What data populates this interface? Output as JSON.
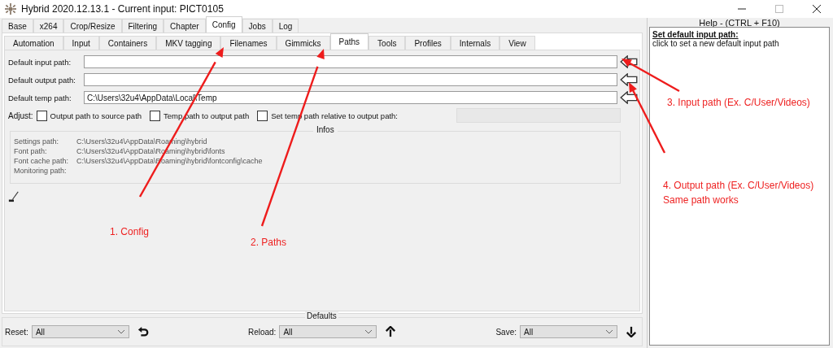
{
  "window": {
    "title": "Hybrid 2020.12.13.1 - Current input: PICT0105"
  },
  "tabs": [
    {
      "label": "Base",
      "selected": false
    },
    {
      "label": "x264",
      "selected": false
    },
    {
      "label": "Crop/Resize",
      "selected": false
    },
    {
      "label": "Filtering",
      "selected": false
    },
    {
      "label": "Chapter",
      "selected": false
    },
    {
      "label": "Config",
      "selected": true
    },
    {
      "label": "Jobs",
      "selected": false
    },
    {
      "label": "Log",
      "selected": false
    }
  ],
  "subtabs": [
    {
      "label": "Automation",
      "selected": false
    },
    {
      "label": "Input",
      "selected": false
    },
    {
      "label": "Containers",
      "selected": false
    },
    {
      "label": "MKV tagging",
      "selected": false
    },
    {
      "label": "Filenames",
      "selected": false
    },
    {
      "label": "Gimmicks",
      "selected": false
    },
    {
      "label": "Paths",
      "selected": true
    },
    {
      "label": "Tools",
      "selected": false
    },
    {
      "label": "Profiles",
      "selected": false
    },
    {
      "label": "Internals",
      "selected": false
    },
    {
      "label": "View",
      "selected": false
    }
  ],
  "paths": [
    {
      "label": "Default input path:"
    },
    {
      "label": "Default output path:"
    },
    {
      "label": "Default temp path:",
      "value": "C:\\Users\\32u4\\AppData\\Local\\Temp"
    }
  ],
  "adjust": {
    "label": "Adjust:",
    "options": [
      {
        "label": "Output path to source path",
        "checked": false
      },
      {
        "label": "Temp path to output path",
        "checked": false
      },
      {
        "label": "Set temp path relative to output path:",
        "checked": false
      }
    ]
  },
  "infos": {
    "title": "Infos",
    "rows": [
      {
        "label": "Settings path:",
        "value": "C:\\Users\\32u4\\AppData\\Roaming\\hybrid"
      },
      {
        "label": "Font path:",
        "value": "C:\\Users\\32u4\\AppData\\Roaming\\hybrid\\fonts"
      },
      {
        "label": "Font cache path:",
        "value": "C:\\Users\\32u4\\AppData\\Roaming\\hybrid\\fontconfig\\cache"
      },
      {
        "label": "Monitoring path:"
      }
    ]
  },
  "defaults": {
    "title": "Defaults",
    "controls": [
      {
        "label": "Reset:",
        "value": "All",
        "kind": "undo"
      },
      {
        "label": "Reload:",
        "value": "All",
        "kind": "up"
      },
      {
        "label": "Save:",
        "value": "All",
        "kind": "down"
      }
    ]
  },
  "help": {
    "title": "Help - (CTRL + F10)",
    "heading": "Set default input path:",
    "text": "click to set a new default input path"
  },
  "annotations": [
    {
      "lines": [
        "1. Config"
      ]
    },
    {
      "lines": [
        "2. Paths"
      ]
    },
    {
      "lines": [
        "3. Input path (Ex. C/User/Videos)"
      ]
    },
    {
      "lines": [
        "4. Output path (Ex. C/User/Videos)",
        "Same path works"
      ]
    }
  ]
}
